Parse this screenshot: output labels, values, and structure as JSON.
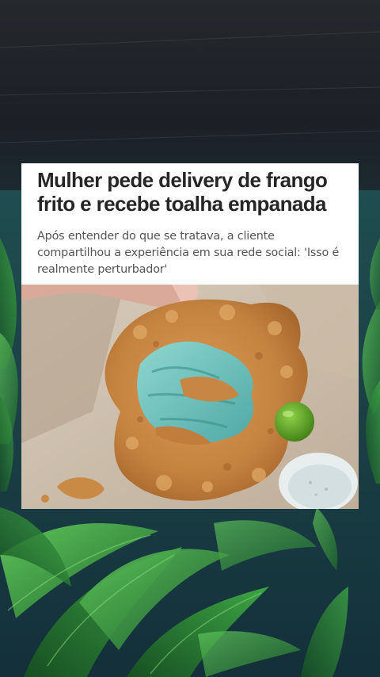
{
  "article": {
    "headline": "Mulher pede delivery de frango frito e recebe toalha empanada",
    "subtitle": "Após entender do que se tratava, a cliente compartilhou a experiência em sua rede social: 'Isso é realmente perturbador'"
  },
  "colors": {
    "sky_dark": "#1e2228",
    "sea_teal": "#1f4f52",
    "leaf_green": "#2f8a3a",
    "card_bg": "#ffffff",
    "headline_text": "#262626",
    "subtitle_text": "#555555",
    "fried_crust": "#c98a45",
    "towel_blue": "#6fc2bd",
    "lime": "#4a9a1e"
  },
  "icons": {
    "photo": "fried-towel-photo"
  }
}
